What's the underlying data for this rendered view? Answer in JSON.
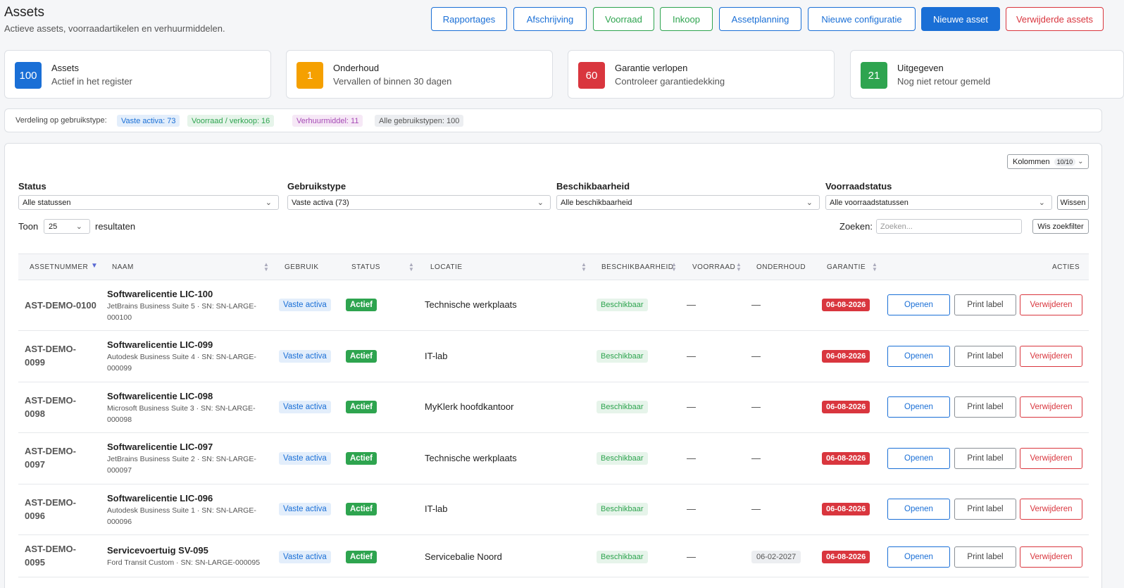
{
  "header": {
    "title": "Assets",
    "subtitle": "Actieve assets, voorraadartikelen en verhuurmiddelen.",
    "buttons": [
      "Rapportages",
      "Afschrijving",
      "Voorraad",
      "Inkoop",
      "Assetplanning",
      "Nieuwe configuratie",
      "Nieuwe asset",
      "Verwijderde assets"
    ]
  },
  "cards": [
    {
      "value": "100",
      "title": "Assets",
      "subtitle": "Actief in het register",
      "color": "#1a6fd6"
    },
    {
      "value": "1",
      "title": "Onderhoud",
      "subtitle": "Vervallen of binnen 30 dagen",
      "color": "#f5a000"
    },
    {
      "value": "60",
      "title": "Garantie verlopen",
      "subtitle": "Controleer garantiedekking",
      "color": "#d9363e"
    },
    {
      "value": "21",
      "title": "Uitgegeven",
      "subtitle": "Nog niet retour gemeld",
      "color": "#2ea44f"
    }
  ],
  "distribution": {
    "label": "Verdeling op gebruikstype:",
    "pills": [
      "Vaste activa: 73",
      "Voorraad / verkoop: 16",
      "Verhuurmiddel: 11",
      "Alle gebruikstypen: 100"
    ]
  },
  "columns_button": {
    "label": "Kolommen",
    "count": "10/10"
  },
  "filters": {
    "status": {
      "label": "Status",
      "value": "Alle statussen"
    },
    "gebruikstype": {
      "label": "Gebruikstype",
      "value": "Vaste activa (73)"
    },
    "beschikbaarheid": {
      "label": "Beschikbaarheid",
      "value": "Alle beschikbaarheid"
    },
    "voorraadstatus": {
      "label": "Voorraadstatus",
      "value": "Alle voorraadstatussen"
    },
    "clear": "Wissen"
  },
  "pager": {
    "toon": "Toon",
    "per_page": "25",
    "resultaten": "resultaten"
  },
  "search": {
    "label": "Zoeken:",
    "placeholder": "Zoeken...",
    "clear": "Wis zoekfilter"
  },
  "table": {
    "headers": [
      "ASSETNUMMER",
      "NAAM",
      "GEBRUIK",
      "STATUS",
      "LOCATIE",
      "BESCHIKBAARHEID",
      "VOORRAAD",
      "ONDERHOUD",
      "GARANTIE",
      "ACTIES"
    ],
    "actions": {
      "open": "Openen",
      "print": "Print label",
      "delete": "Verwijderen"
    },
    "rows": [
      {
        "asset_l1": "AST-DEMO-0100",
        "asset_l2": "",
        "name": "Softwarelicentie LIC-100",
        "sub": "JetBrains Business Suite 5 · SN: SN-LARGE-000100",
        "gebruik": "Vaste activa",
        "status": "Actief",
        "locatie": "Technische werkplaats",
        "beschikbaarheid": "Beschikbaar",
        "voorraad": "—",
        "onderhoud": "—",
        "garantie": "06-08-2026"
      },
      {
        "asset_l1": "AST-DEMO-",
        "asset_l2": "0099",
        "name": "Softwarelicentie LIC-099",
        "sub": "Autodesk Business Suite 4 · SN: SN-LARGE-000099",
        "gebruik": "Vaste activa",
        "status": "Actief",
        "locatie": "IT-lab",
        "beschikbaarheid": "Beschikbaar",
        "voorraad": "—",
        "onderhoud": "—",
        "garantie": "06-08-2026"
      },
      {
        "asset_l1": "AST-DEMO-",
        "asset_l2": "0098",
        "name": "Softwarelicentie LIC-098",
        "sub": "Microsoft Business Suite 3 · SN: SN-LARGE-000098",
        "gebruik": "Vaste activa",
        "status": "Actief",
        "locatie": "MyKlerk hoofdkantoor",
        "beschikbaarheid": "Beschikbaar",
        "voorraad": "—",
        "onderhoud": "—",
        "garantie": "06-08-2026"
      },
      {
        "asset_l1": "AST-DEMO-",
        "asset_l2": "0097",
        "name": "Softwarelicentie LIC-097",
        "sub": "JetBrains Business Suite 2 · SN: SN-LARGE-000097",
        "gebruik": "Vaste activa",
        "status": "Actief",
        "locatie": "Technische werkplaats",
        "beschikbaarheid": "Beschikbaar",
        "voorraad": "—",
        "onderhoud": "—",
        "garantie": "06-08-2026"
      },
      {
        "asset_l1": "AST-DEMO-",
        "asset_l2": "0096",
        "name": "Softwarelicentie LIC-096",
        "sub": "Autodesk Business Suite 1 · SN: SN-LARGE-000096",
        "gebruik": "Vaste activa",
        "status": "Actief",
        "locatie": "IT-lab",
        "beschikbaarheid": "Beschikbaar",
        "voorraad": "—",
        "onderhoud": "—",
        "garantie": "06-08-2026"
      },
      {
        "asset_l1": "AST-DEMO-",
        "asset_l2": "0095",
        "name": "Servicevoertuig SV-095",
        "sub": "Ford Transit Custom · SN: SN-LARGE-000095",
        "gebruik": "Vaste activa",
        "status": "Actief",
        "locatie": "Servicebalie Noord",
        "beschikbaarheid": "Beschikbaar",
        "voorraad": "—",
        "onderhoud": "06-02-2027",
        "garantie": "06-08-2026"
      }
    ]
  }
}
